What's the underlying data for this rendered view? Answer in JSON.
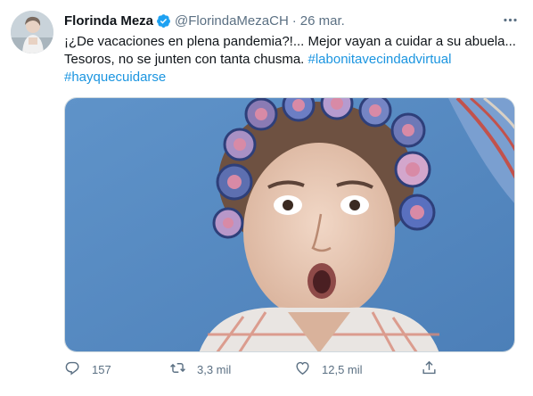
{
  "tweet": {
    "author": {
      "name": "Florinda Meza",
      "handle": "@FlorindaMezaCH",
      "date": "26 mar.",
      "verified": true
    },
    "text": {
      "line1": "¡¿De vacaciones en plena pandemia?!... Mejor vayan a cuidar a su abuela...",
      "line2_prefix": "Tesoros, no se junten con tanta chusma.",
      "hashtag1": "#labonitavecindadvirtual",
      "hashtag2": "#hayquecuidarse"
    },
    "media": {
      "kind": "photo",
      "description_icon": "woman-with-hair-rollers-photo"
    },
    "actions": {
      "reply_count": "157",
      "retweet_count": "3,3 mil",
      "like_count": "12,5 mil"
    },
    "colors": {
      "link": "#1b95e0",
      "verified": "#1da1f2",
      "muted": "#5b7083"
    }
  }
}
